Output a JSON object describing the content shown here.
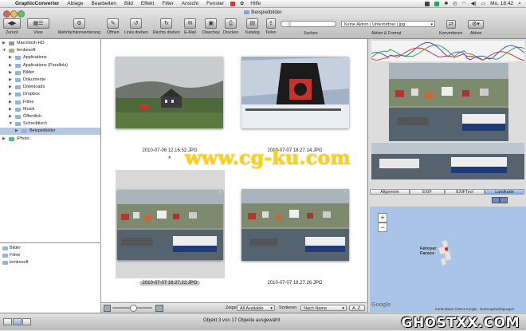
{
  "menubar": {
    "app_name": "GraphicConverter",
    "items": [
      "Ablage",
      "Bearbeiten",
      "Bild",
      "Effekt",
      "Filter",
      "Ansicht",
      "Fenster",
      "Hilfe"
    ],
    "clock": "Mo. 18:42"
  },
  "window": {
    "title": "Beispielbilder"
  },
  "toolbar": {
    "buttons": [
      "Zurück",
      "View",
      "Mehrfachkonvertierung",
      "Öffnen",
      "Links drehen",
      "Rechts drehen",
      "E-Mail",
      "Diaschau",
      "Drucken",
      "Katalog",
      "Teilen"
    ],
    "search_label": "Suchen",
    "search_placeholder": "Q",
    "path_value": "Keine Aktion | Unterordner | jpg",
    "action_label": "Aktion & Format",
    "convert_label": "Konvertieren",
    "aktion_label": "Aktion"
  },
  "sidebar": {
    "items": [
      {
        "label": "Macintosh HD",
        "indent": 0,
        "open": false,
        "icon": "hard-drive-icon"
      },
      {
        "label": "lemkesoft",
        "indent": 0,
        "open": true,
        "icon": "home-icon"
      },
      {
        "label": "Applications",
        "indent": 1,
        "open": false,
        "icon": "folder-icon"
      },
      {
        "label": "Applications (Parallels)",
        "indent": 1,
        "open": false,
        "icon": "folder-icon"
      },
      {
        "label": "Bilder",
        "indent": 1,
        "open": false,
        "icon": "folder-icon"
      },
      {
        "label": "Dokumente",
        "indent": 1,
        "open": false,
        "icon": "folder-icon"
      },
      {
        "label": "Downloads",
        "indent": 1,
        "open": false,
        "icon": "folder-icon"
      },
      {
        "label": "Dropbox",
        "indent": 1,
        "open": false,
        "icon": "folder-icon"
      },
      {
        "label": "Filme",
        "indent": 1,
        "open": false,
        "icon": "folder-icon"
      },
      {
        "label": "Musik",
        "indent": 1,
        "open": false,
        "icon": "folder-icon"
      },
      {
        "label": "Öffentlich",
        "indent": 1,
        "open": false,
        "icon": "folder-icon"
      },
      {
        "label": "Schreibtisch",
        "indent": 1,
        "open": true,
        "icon": "folder-icon"
      },
      {
        "label": "Beispielbilder",
        "indent": 2,
        "open": false,
        "icon": "folder-icon",
        "selected": true
      },
      {
        "label": "iPhoto",
        "indent": 0,
        "open": false,
        "icon": "iphoto-icon"
      }
    ],
    "favorites": [
      "Bilder",
      "Filme",
      "lemkesoft"
    ]
  },
  "thumbnails": [
    {
      "filename": "2010-07-06 12.16.52.JPG",
      "scene": "farmhouse",
      "selected": false
    },
    {
      "filename": "2010-07-07 18.27.14.JPG",
      "scene": "ship-funnel",
      "selected": false
    },
    {
      "filename": "2010-07-07 18.27.22.JPG",
      "scene": "harbor",
      "selected": true
    },
    {
      "filename": "2010-07-07 18.27.26.JPG",
      "scene": "harbor2",
      "selected": false
    }
  ],
  "browser_bottom": {
    "zeige_label": "Zeige",
    "zeige_value": "All Available",
    "sort_label": "Sortieren",
    "sort_value": "Nach Name",
    "order_value": "A..Z"
  },
  "rpanel": {
    "tabs": [
      "Allgemein",
      "EXIF",
      "EXIFTool",
      "Landkarte"
    ],
    "active_tab": "Landkarte",
    "map_type": "Standard",
    "zoom_in": "+",
    "zoom_out": "−",
    "map_place": "Føroyar\nFaroes",
    "map_attribution": "Kartendaten ©2013 Google · Nutzungsbedingungen",
    "google_logo": "Google"
  },
  "status": {
    "text": "Objekt 3 von 17 Objekte ausgewählt"
  },
  "overlay_watermark_center": "www.cg-ku.com",
  "overlay_watermark_corner": "GHOSTXX.COM",
  "colors": {
    "selection": "#b8c8e0",
    "menubar": "#f0f0f0",
    "map_water": "#a9c4e6",
    "histogram_green": "#3fa34d",
    "histogram_blue": "#3b5bdb",
    "histogram_red": "#d63d3d",
    "watermark_yellow": "#ffd400"
  }
}
